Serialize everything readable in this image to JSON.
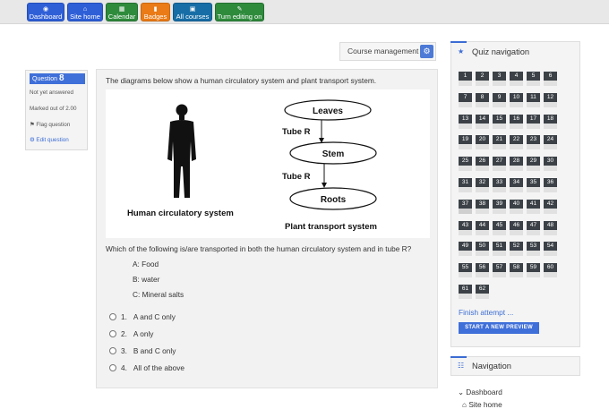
{
  "topbar": {
    "buttons": [
      {
        "label": "Dashboard",
        "icon": "dashboard-icon",
        "color": "#2f5fd7"
      },
      {
        "label": "Site home",
        "icon": "home-icon",
        "color": "#2f5fd7"
      },
      {
        "label": "Calendar",
        "icon": "calendar-icon",
        "color": "#2e8b3c"
      },
      {
        "label": "Badges",
        "icon": "bookmark-icon",
        "color": "#ea7b16"
      },
      {
        "label": "All courses",
        "icon": "book-icon",
        "color": "#176ea6"
      },
      {
        "label": "Turn editing on",
        "icon": "edit-icon",
        "color": "#2e8b3c"
      }
    ]
  },
  "course_management": {
    "label": "Course management",
    "icon": "gear-icon"
  },
  "question_info": {
    "label": "Question",
    "number": "8",
    "status": "Not yet answered",
    "marks": "Marked out of 2.00",
    "flag": "Flag question",
    "edit": "Edit question"
  },
  "question": {
    "intro": "The diagrams below show a human circulatory system and plant transport system.",
    "diagram": {
      "human_caption": "Human circulatory system",
      "plant_caption": "Plant transport system",
      "nodes": [
        "Leaves",
        "Stem",
        "Roots"
      ],
      "tube_labels": [
        "Tube R",
        "Tube R"
      ]
    },
    "stem": "Which of the following is/are transported in both the human circulatory system and in tube R?",
    "items": [
      "A: Food",
      "B: water",
      "C: Mineral salts"
    ],
    "options": [
      {
        "num": "1.",
        "text": "A and C only"
      },
      {
        "num": "2.",
        "text": "A only"
      },
      {
        "num": "3.",
        "text": "B and C only"
      },
      {
        "num": "4.",
        "text": "All of the above"
      }
    ]
  },
  "quiz_nav": {
    "title": "Quiz navigation",
    "icon": "pin-icon",
    "numbers": [
      "1",
      "2",
      "3",
      "4",
      "5",
      "6",
      "7",
      "8",
      "9",
      "10",
      "11",
      "12",
      "13",
      "14",
      "15",
      "16",
      "17",
      "18",
      "19",
      "20",
      "21",
      "22",
      "23",
      "24",
      "25",
      "26",
      "27",
      "28",
      "29",
      "30",
      "31",
      "32",
      "33",
      "34",
      "35",
      "36",
      "37",
      "38",
      "39",
      "40",
      "41",
      "42",
      "43",
      "44",
      "45",
      "46",
      "47",
      "48",
      "49",
      "50",
      "51",
      "52",
      "53",
      "54",
      "55",
      "56",
      "57",
      "58",
      "59",
      "60",
      "61",
      "62"
    ],
    "current": "37",
    "finish": "Finish attempt ...",
    "preview": "START A NEW PREVIEW"
  },
  "navigation": {
    "title": "Navigation",
    "icon": "sitemap-icon",
    "items": [
      "Dashboard",
      "Site home"
    ]
  },
  "colors": {
    "accent": "#3b6cd4",
    "nav_button": "#3b4147"
  }
}
